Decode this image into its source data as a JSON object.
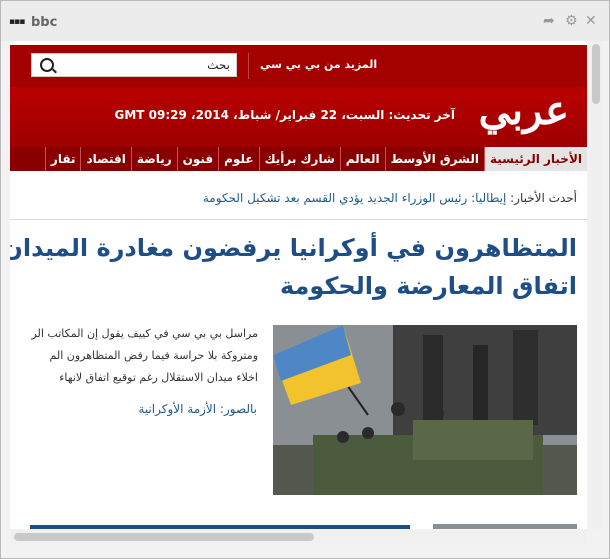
{
  "window": {
    "title": "bbc"
  },
  "header": {
    "search_placeholder": "بحث",
    "more_link": "المزيد من بي بي سي",
    "brand": "عربي",
    "updated": "آخر تحديث:  السبت، 22 فبراير/ شباط، 2014، GMT 09:29"
  },
  "nav": {
    "items": [
      "الأخبار الرئيسية",
      "الشرق الأوسط",
      "العالم",
      "شارك برأيك",
      "علوم",
      "فنون",
      "رياضة",
      "اقتصاد",
      "تقار"
    ]
  },
  "breaking": {
    "label": "أحدث الأخبار:",
    "text": "إيطاليا: رئيس الوزراء الجديد يؤدي القسم بعد تشكيل الحكومة"
  },
  "article": {
    "headline_line1": "المتظاهرون في أوكرانيا يرفضون مغادرة الميدان رغ",
    "headline_line2": "اتفاق المعارضة والحكومة",
    "summary_lines": [
      "مراسل بي بي سي في كييف يقول إن المكاتب الر",
      "ومتروكة بلا حراسة فيما رفض المتظاهرون الم",
      "اخلاء ميدان الاستقلال رغم توقيع اتفاق لانهاء"
    ],
    "photos_link": "بالصور: الأزمة الأوكرانية"
  },
  "colors": {
    "brand_red": "#a30000",
    "link_blue": "#1f5a8a",
    "headline_blue": "#1f4e86"
  }
}
